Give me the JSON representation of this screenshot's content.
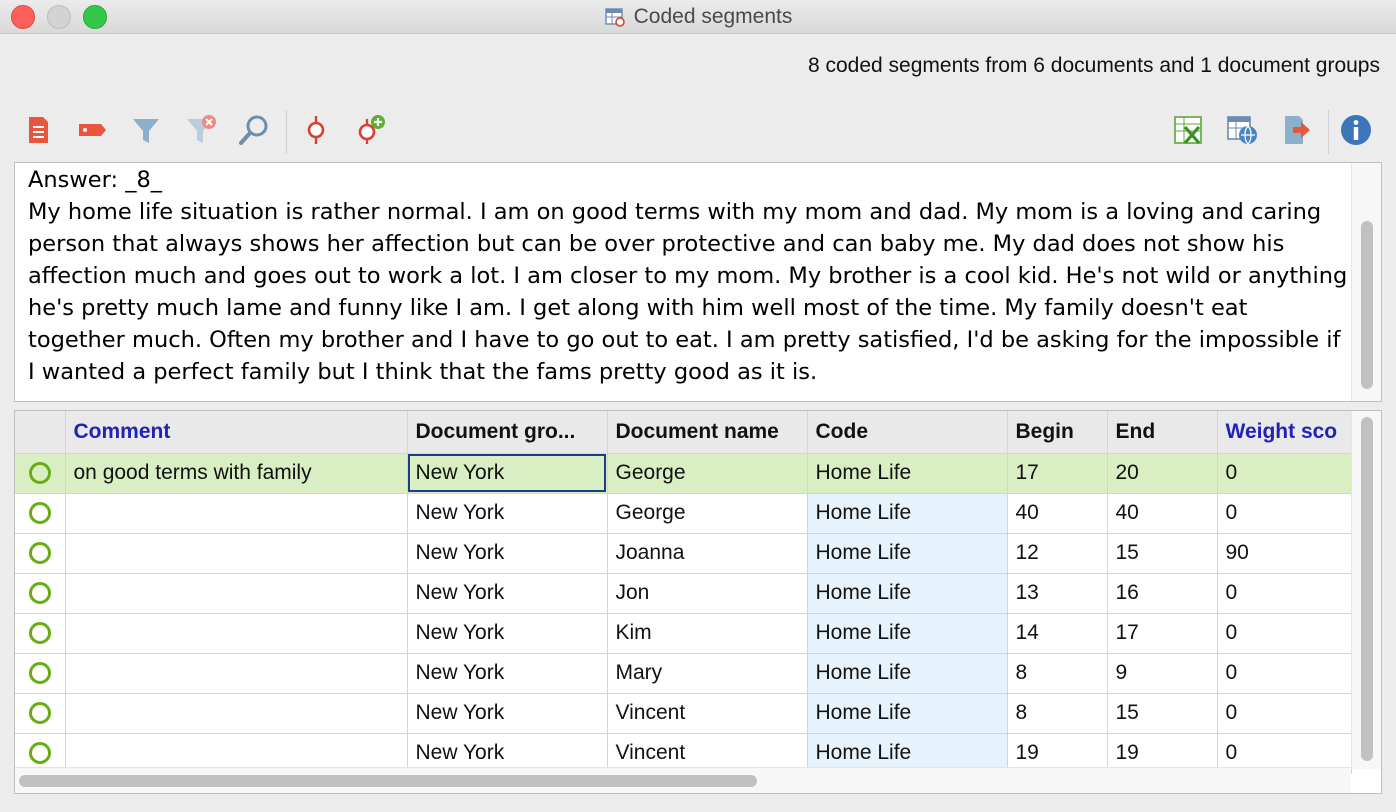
{
  "window": {
    "title": "Coded segments"
  },
  "summary": "8 coded segments from 6 documents and 1 document groups",
  "toolbar": {
    "left": [
      {
        "icon": "document-list-icon",
        "color": "#e8563d"
      },
      {
        "icon": "code-tag-icon",
        "color": "#e8563d"
      },
      {
        "icon": "filter-icon",
        "color": "#8ab0cc"
      },
      {
        "icon": "filter-clear-icon",
        "color": "#8ab0cc"
      },
      {
        "icon": "search-icon",
        "color": "#6d8fa8"
      },
      {
        "icon": "segment-pin-icon",
        "color": "#d9412e"
      },
      {
        "icon": "segment-pin-add-icon",
        "color": "#d9412e"
      }
    ],
    "right": [
      {
        "icon": "excel-export-icon",
        "color": "#5aa83a"
      },
      {
        "icon": "html-export-icon",
        "color": "#4a86c5"
      },
      {
        "icon": "export-icon",
        "color": "#e8563d"
      },
      {
        "icon": "info-icon",
        "color": "#3d75b8"
      }
    ]
  },
  "text_preview": {
    "heading": "Answer: _8_",
    "body": "My home life situation is rather normal. I am on good terms with my mom and dad. My mom is a loving and caring person that always shows her affection but can be over protective and can baby me. My dad does not show his affection much and goes out to work a lot. I am closer to my mom. My brother is a cool kid. He's not wild or anything he's pretty much lame and funny like I am. I get along with him well most of the time. My family doesn't eat together much. Often my brother and I have to go out to eat.  I am pretty satisfied, I'd be asking for the impossible if I wanted a perfect family but I think that the fams pretty good as it is."
  },
  "table": {
    "columns": [
      "",
      "Comment",
      "Document gro...",
      "Document name",
      "Code",
      "Begin",
      "End",
      "Weight sco"
    ],
    "rows": [
      [
        "",
        "on good terms with family",
        "New York",
        "George",
        "Home Life",
        "17",
        "20",
        "0"
      ],
      [
        "",
        "",
        "New York",
        "George",
        "Home Life",
        "40",
        "40",
        "0"
      ],
      [
        "",
        "",
        "New York",
        "Joanna",
        "Home Life",
        "12",
        "15",
        "90"
      ],
      [
        "",
        "",
        "New York",
        "Jon",
        "Home Life",
        "13",
        "16",
        "0"
      ],
      [
        "",
        "",
        "New York",
        "Kim",
        "Home Life",
        "14",
        "17",
        "0"
      ],
      [
        "",
        "",
        "New York",
        "Mary",
        "Home Life",
        "8",
        "9",
        "0"
      ],
      [
        "",
        "",
        "New York",
        "Vincent",
        "Home Life",
        "8",
        "15",
        "0"
      ],
      [
        "",
        "",
        "New York",
        "Vincent",
        "Home Life",
        "19",
        "19",
        "0"
      ]
    ],
    "selected_row": 0,
    "colors": {
      "selected_row": "#d9eec2",
      "code_column": "#e7f3fc",
      "status_circle": "#6aac14",
      "header_blue": "#2222bb"
    }
  }
}
